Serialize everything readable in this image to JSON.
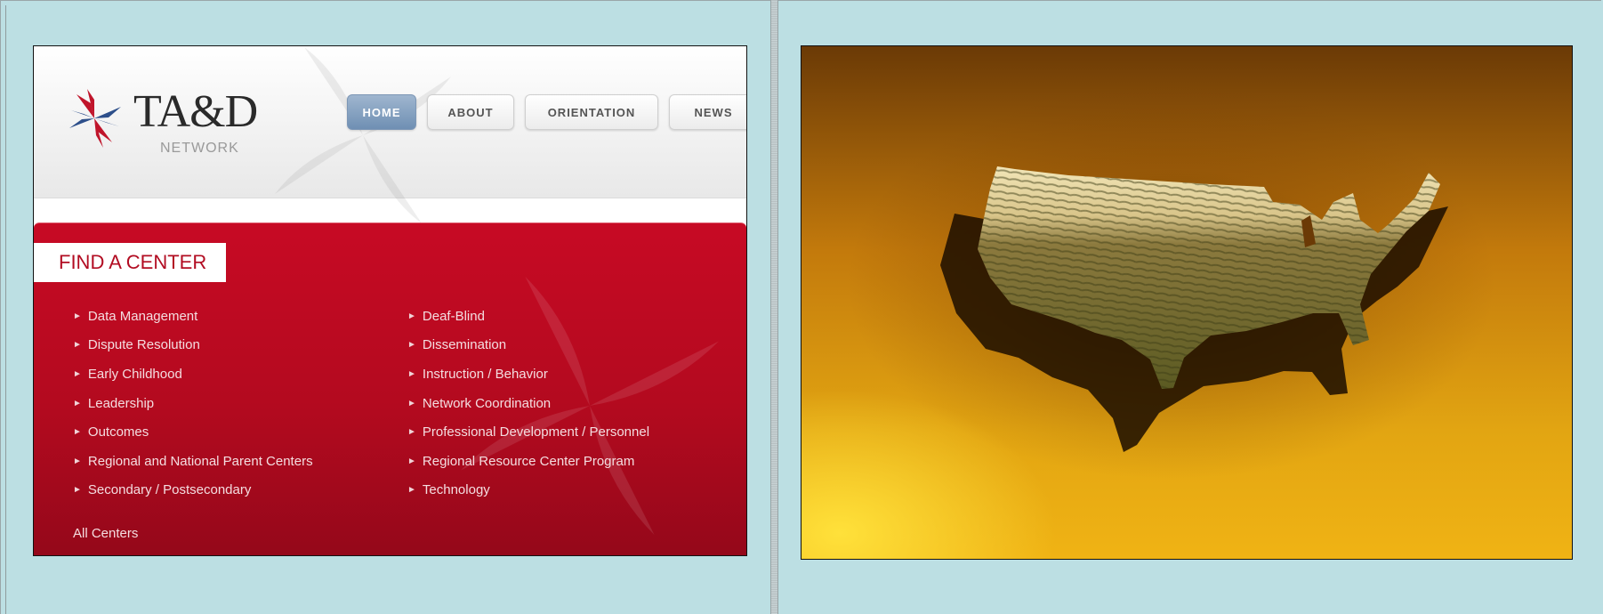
{
  "site": {
    "brand": "TA&D",
    "brand_sub": "NETWORK",
    "nav": [
      {
        "label": "HOME",
        "active": true
      },
      {
        "label": "ABOUT",
        "active": false
      },
      {
        "label": "ORIENTATION",
        "active": false
      },
      {
        "label": "NEWS",
        "active": false
      }
    ],
    "find_center_title": "FIND A CENTER",
    "centers_left": [
      "Data Management",
      "Dispute Resolution",
      "Early Childhood",
      "Leadership",
      "Outcomes",
      "Regional and National Parent Centers",
      "Secondary / Postsecondary"
    ],
    "centers_right": [
      "Deaf-Blind",
      "Dissemination",
      "Instruction / Behavior",
      "Network Coordination",
      "Professional Development / Personnel",
      "Regional Resource Center Program",
      "Technology"
    ],
    "all_centers": "All Centers"
  },
  "colors": {
    "background": "#bcdfe3",
    "red_panel": "#c70a24",
    "nav_active": "#7f9cbd",
    "logo_red": "#c0152b",
    "logo_blue": "#2d4f8a"
  },
  "icons": {
    "logo": "tad-pinwheel-logo",
    "bullet": "triangle-bullet-icon",
    "map": "usa-map-crop-field-image"
  }
}
